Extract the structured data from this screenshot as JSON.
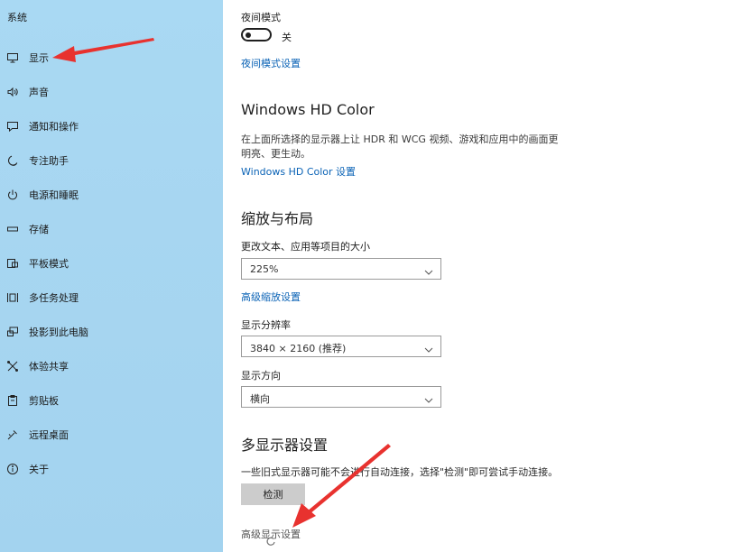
{
  "sidebar": {
    "title": "系统",
    "items": [
      {
        "label": "显示",
        "icon": "monitor-icon"
      },
      {
        "label": "声音",
        "icon": "speaker-icon"
      },
      {
        "label": "通知和操作",
        "icon": "notification-icon"
      },
      {
        "label": "专注助手",
        "icon": "moon-icon"
      },
      {
        "label": "电源和睡眠",
        "icon": "power-icon"
      },
      {
        "label": "存储",
        "icon": "storage-icon"
      },
      {
        "label": "平板模式",
        "icon": "tablet-icon"
      },
      {
        "label": "多任务处理",
        "icon": "multitask-icon"
      },
      {
        "label": "投影到此电脑",
        "icon": "project-icon"
      },
      {
        "label": "体验共享",
        "icon": "share-icon"
      },
      {
        "label": "剪贴板",
        "icon": "clipboard-icon"
      },
      {
        "label": "远程桌面",
        "icon": "remote-desktop-icon"
      },
      {
        "label": "关于",
        "icon": "info-icon"
      }
    ]
  },
  "night_mode": {
    "label": "夜间模式",
    "toggle_state": "关",
    "settings_link": "夜间模式设置"
  },
  "hd_color": {
    "title": "Windows HD Color",
    "description": "在上面所选择的显示器上让 HDR 和 WCG 视频、游戏和应用中的画面更明亮、更生动。",
    "link": "Windows HD Color 设置"
  },
  "scale_layout": {
    "title": "缩放与布局",
    "scale_label": "更改文本、应用等项目的大小",
    "scale_value": "225%",
    "advanced_scale_link": "高级缩放设置",
    "resolution_label": "显示分辨率",
    "resolution_value": "3840 × 2160 (推荐)",
    "orientation_label": "显示方向",
    "orientation_value": "横向"
  },
  "multi_display": {
    "title": "多显示器设置",
    "description": "一些旧式显示器可能不会进行自动连接，选择\"检测\"即可尝试手动连接。",
    "detect_button": "检测",
    "advanced_link": "高级显示设置"
  },
  "colors": {
    "sidebar_bg": "#a9d9f3",
    "link": "#0b63b6",
    "annotation_arrow": "#e8322f"
  }
}
